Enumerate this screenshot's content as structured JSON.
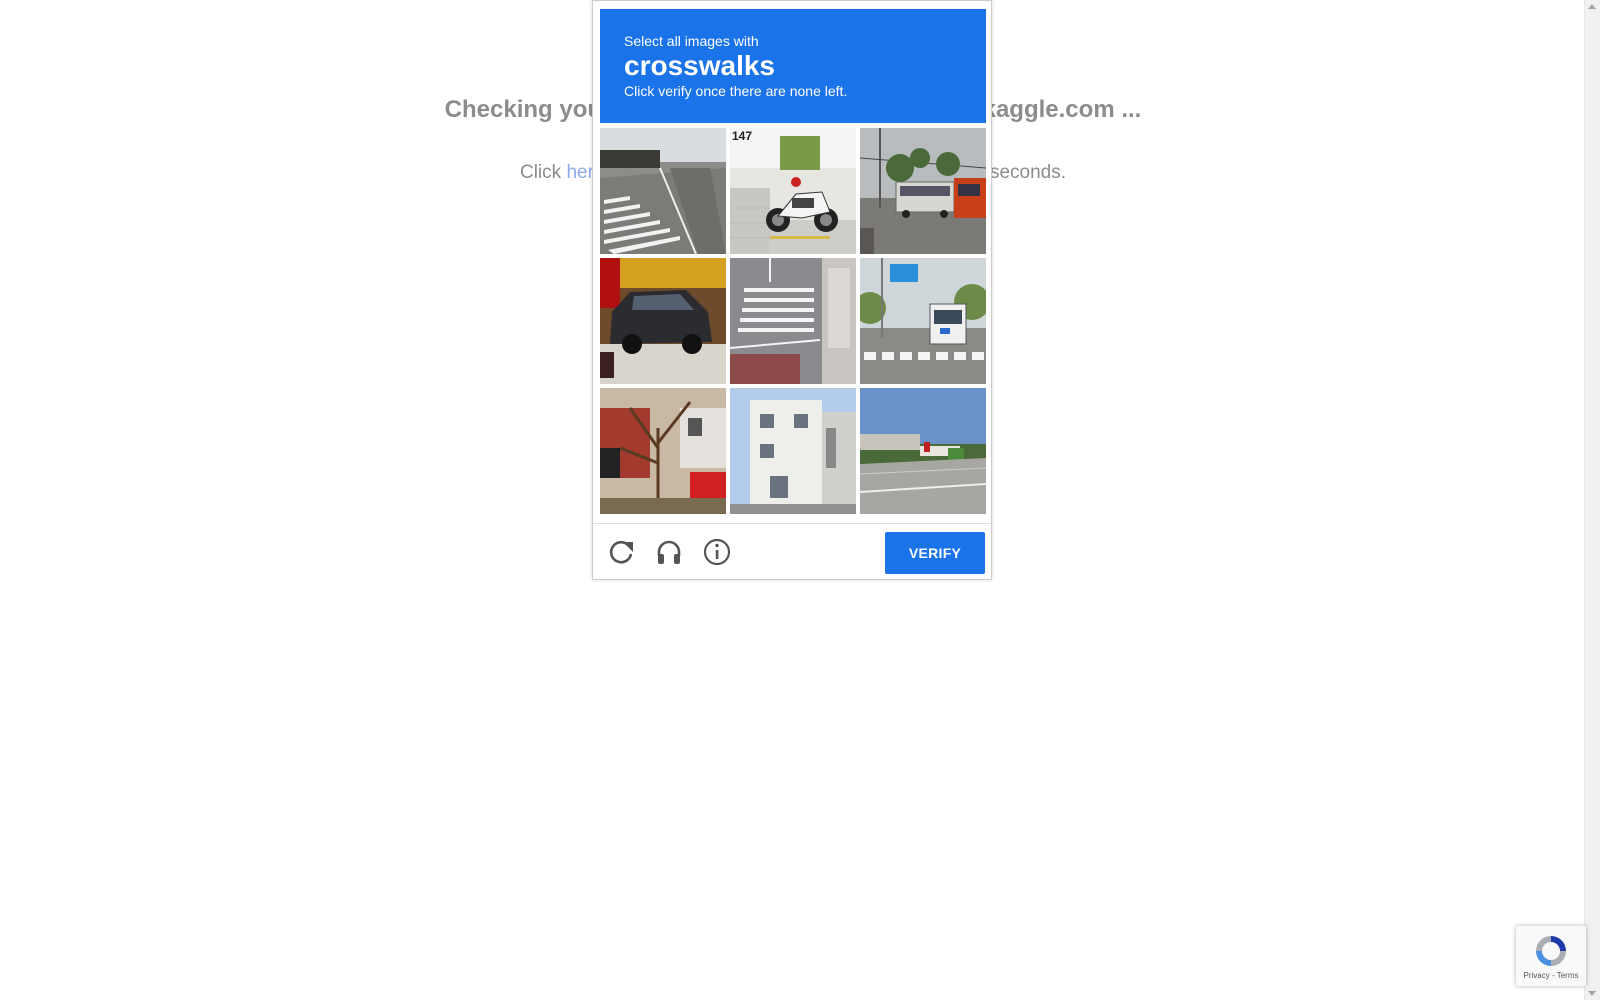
{
  "background": {
    "heading": "Checking your browser before accessing www.kaggle.com ...",
    "line_prefix": "Click ",
    "line_link": "here",
    "line_suffix": " if you are not automatically redirected after 5 seconds."
  },
  "captcha": {
    "prompt": "Select all images with",
    "target": "crosswalks",
    "instruction": "Click verify once there are none left.",
    "tiles": [
      {
        "label": "road with crosswalk"
      },
      {
        "label": "motorcycle 147"
      },
      {
        "label": "street with buses"
      },
      {
        "label": "parked car"
      },
      {
        "label": "crosswalk intersection"
      },
      {
        "label": "bus at crosswalk"
      },
      {
        "label": "tree and houses"
      },
      {
        "label": "white building"
      },
      {
        "label": "highway overpass"
      }
    ],
    "tile_number_text": "147",
    "verify_label": "VERIFY",
    "icons": [
      "reload-icon",
      "headphones-icon",
      "info-icon"
    ]
  },
  "badge": {
    "privacy": "Privacy",
    "separator": " - ",
    "terms": "Terms"
  },
  "colors": {
    "accent": "#1a73e8",
    "background_text": "#8c8c8c",
    "link": "#8ea9e8"
  }
}
